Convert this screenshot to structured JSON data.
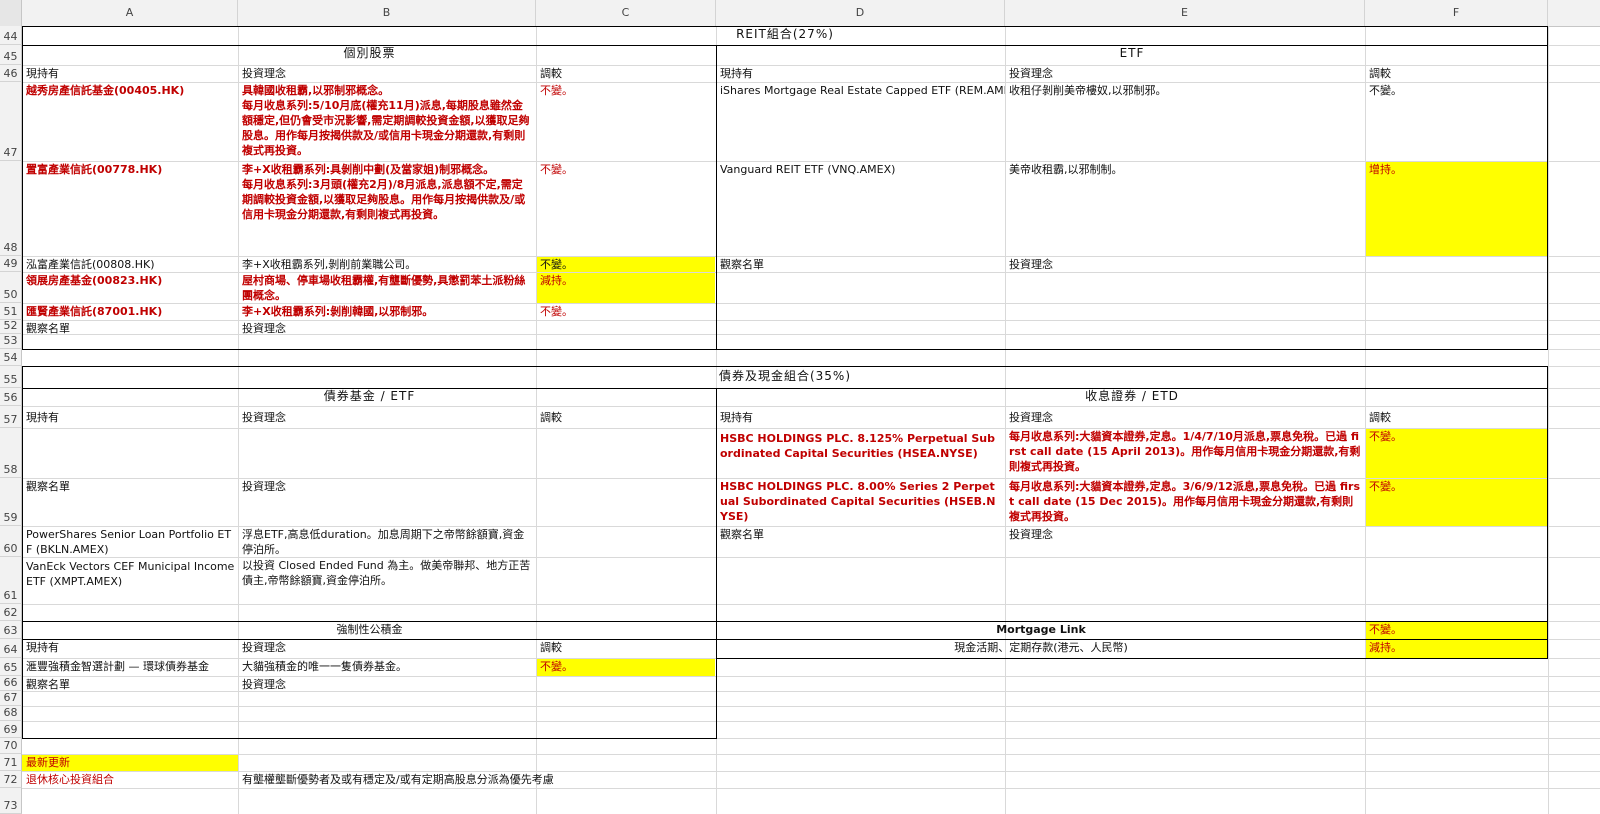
{
  "columns": [
    "A",
    "B",
    "C",
    "D",
    "E",
    "F"
  ],
  "rows": [
    "44",
    "45",
    "46",
    "47",
    "48",
    "49",
    "50",
    "51",
    "52",
    "53",
    "54",
    "55",
    "56",
    "57",
    "58",
    "59",
    "60",
    "61",
    "62",
    "63",
    "64",
    "65",
    "66",
    "67",
    "68",
    "69",
    "70",
    "71",
    "72",
    "73"
  ],
  "reit": {
    "title": "REIT組合(27%)",
    "stocks_header": "個別股票",
    "etf_header": "ETF",
    "col_holding": "現持有",
    "col_idea": "投資理念",
    "col_adjust": "調較",
    "stocks": [
      {
        "name": "越秀房產信託基金(00405.HK)",
        "idea": "具韓國收租霸,以邪制邪概念。\n每月收息系列:5/10月底(權充11月)派息,每期股息雖然金額穩定,但仍會受市況影響,需定期調較投資金額,以獲取足夠股息。用作每月按揭供款及/或信用卡現金分期還款,有剩則複式再投資。",
        "adjust": "不變。"
      },
      {
        "name": "置富產業信託(00778.HK)",
        "idea": "李+X收租霸系列:具剝削中劃(及當家姐)制邪概念。\n每月收息系列:3月頭(權充2月)/8月派息,派息額不定,需定期調較投資金額,以獲取足夠股息。用作每月按揭供款及/或信用卡現金分期還款,有剩則複式再投資。",
        "adjust": "不變。"
      },
      {
        "name": "泓富產業信託(00808.HK)",
        "idea": "李+X收租霸系列,剝削前業職公司。",
        "adjust": "不變。"
      },
      {
        "name": "領展房產基金(00823.HK)",
        "idea": "屋村商場、停車場收租霸權,有壟斷優勢,具懲罰苯土派粉絲團概念。",
        "adjust": "減持。"
      },
      {
        "name": "匯賢產業信託(87001.HK)",
        "idea": "李+X收租霸系列:剝削韓國,以邪制邪。",
        "adjust": "不變。"
      }
    ],
    "stocks_watch": "觀察名單",
    "stocks_watch_idea": "投資理念",
    "etfs": [
      {
        "name": "iShares Mortgage Real Estate Capped ETF (REM.AMEX)",
        "idea": "收租仔剝削美帝樓奴,以邪制邪。",
        "adjust": "不變。"
      },
      {
        "name": "Vanguard REIT ETF (VNQ.AMEX)",
        "idea": "美帝收租霸,以邪制制。",
        "adjust": "增持。"
      }
    ],
    "etf_watch": "觀察名單",
    "etf_watch_idea": "投資理念"
  },
  "bond": {
    "title": "債券及現金組合(35%)",
    "fund_header": "債券基金 / ETF",
    "etd_header": "收息證券 / ETD",
    "col_holding": "現持有",
    "col_idea": "投資理念",
    "col_adjust": "調較",
    "fund_watch": "觀察名單",
    "fund_watch_idea": "投資理念",
    "fund_watch_items": [
      {
        "name": "PowerShares Senior Loan Portfolio ETF (BKLN.AMEX)",
        "idea": "浮息ETF,高息低duration。加息周期下之帝幣餘額寶,資金停泊所。"
      },
      {
        "name": "VanEck Vectors CEF Municipal Income ETF (XMPT.AMEX)",
        "idea": "以投資 Closed Ended Fund 為主。做美帝聯邦、地方正苦債主,帝幣餘額寶,資金停泊所。"
      }
    ],
    "etd_items": [
      {
        "name": "HSBC HOLDINGS PLC. 8.125% Perpetual Subordinated Capital Securities (HSEA.NYSE)",
        "idea": "每月收息系列:大貓資本證券,定息。1/4/7/10月派息,票息免稅。已過 first call date (15 April 2013)。用作每月信用卡現金分期還款,有剩則複式再投資。",
        "adjust": "不變。"
      },
      {
        "name": "HSBC HOLDINGS PLC. 8.00% Series 2 Perpetual Subordinated Capital Securities (HSEB.NYSE)",
        "idea": "每月收息系列:大貓資本證券,定息。3/6/9/12派息,票息免稅。已過 first call date (15 Dec 2015)。用作每月信用卡現金分期還款,有剩則複式再投資。",
        "adjust": "不變。"
      }
    ],
    "etd_watch": "觀察名單",
    "etd_watch_idea": "投資理念"
  },
  "mpf": {
    "header": "強制性公積金",
    "col_holding": "現持有",
    "col_idea": "投資理念",
    "col_adjust": "調較",
    "item": {
      "name": "滙豐強積金智選計劃 — 環球債券基金",
      "idea": "大貓強積金的唯一一隻債券基金。",
      "adjust": "不變。"
    },
    "watch": "觀察名單",
    "watch_idea": "投資理念"
  },
  "mortgage": {
    "label": "Mortgage Link",
    "adjust": "不變。"
  },
  "cash": {
    "label": "現金活期、定期存款(港元、人民幣)",
    "adjust": "減持。"
  },
  "footer": {
    "latest_update": "最新更新",
    "retire_core": "退休核心投資組合",
    "note": "有壟權壟斷優勢者及或有穩定及/或有定期高股息分派為優先考慮"
  },
  "colors": {
    "yellow": "#ffff00",
    "red": "#c00000",
    "grid": "#d9d9d9",
    "header_bg": "#f2f2f2"
  }
}
